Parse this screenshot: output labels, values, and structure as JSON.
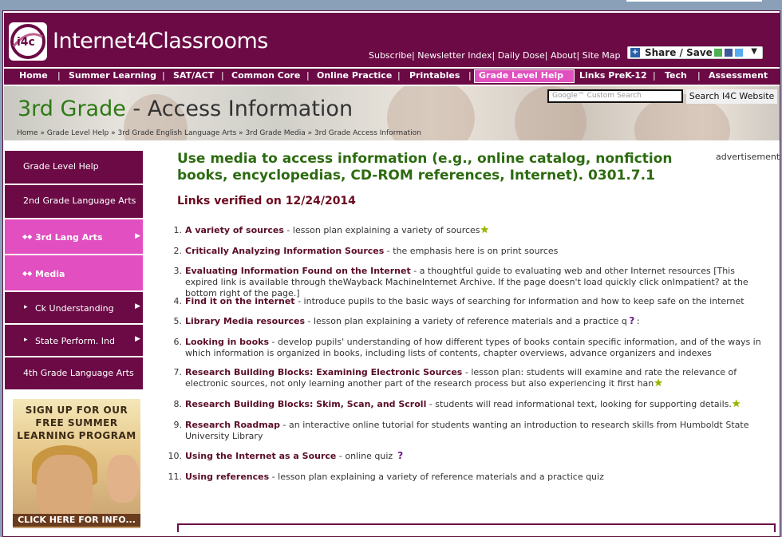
{
  "brand": "Internet4Classrooms",
  "logo_text": "i4c",
  "top_links": [
    "Subscribe",
    "Newsletter Index",
    "Daily Dose",
    "About",
    "Site Map"
  ],
  "share_label": "Share / Save",
  "nav": [
    "Home",
    "Summer Learning",
    "SAT/ACT",
    "Common Core",
    "Online Practice",
    "Printables",
    "Grade Level Help",
    "Links PreK-12",
    "Tech",
    "Assessment"
  ],
  "nav_active": "Grade Level Help",
  "page_title_part1": "3rd Grade",
  "page_title_part2": " - Access Information",
  "breadcrumbs": "Home » Grade Level Help » 3rd Grade English Language Arts » 3rd Grade Media » 3rd Grade Access Information",
  "search": {
    "placeholder": "Google™ Custom Search",
    "button": "Search I4C Website"
  },
  "sidebar": [
    {
      "label": "Grade Level Help"
    },
    {
      "label": "2nd Grade Language Arts"
    },
    {
      "label": "3rd Lang Arts"
    },
    {
      "label": "Media"
    },
    {
      "label": "Ck Understanding"
    },
    {
      "label": "State Perform. Ind"
    },
    {
      "label": "4th Grade Language Arts"
    }
  ],
  "promo": {
    "line1": "SIGN UP FOR OUR",
    "line2": "FREE SUMMER",
    "line3": "LEARNING PROGRAM",
    "cta": "CLICK HERE FOR INFO..."
  },
  "main_heading": "Use media to access information (e.g., online catalog, nonfiction books, encyclopedias, CD-ROM references, Internet). 0301.7.1",
  "verified": "Links verified on 12/24/2014",
  "advertisement": "advertisement",
  "links": [
    {
      "num": "1.",
      "title": "A variety of sources",
      "desc": " - lesson plan explaining a variety of sources"
    },
    {
      "num": "2.",
      "title": "Critically Analyzing Information Sources",
      "desc": " - the emphasis here is on print sources"
    },
    {
      "num": "3.",
      "title": "Evaluating Information Found on the Internet",
      "desc": "  - a thoughtful guide to evaluating web and other Internet resources [This expired link is available through theWayback MachineInternet Archive. If the page doesn't load quickly click onImpatient? at the bottom right of the page.]"
    },
    {
      "num": "4.",
      "title": "Find it on the internet",
      "desc": "  - introduce pupils to the basic ways of searching for information and how to keep safe on the internet"
    },
    {
      "num": "5.",
      "title": "Library Media resources",
      "desc": " - lesson plan explaining a variety of reference materials and a practice q"
    },
    {
      "num": "6.",
      "title": "Looking in books",
      "desc": "  - develop pupils' understanding of how different types of books contain specific information, and of the ways in which information is organized in books, including lists of contents, chapter overviews, advance organizers and indexes"
    },
    {
      "num": "7.",
      "title": "Research Building Blocks: Examining Electronic Sources",
      "desc": "  - lesson plan: students will examine and rate the relevance of electronic sources, not only learning another part of the research process but also experiencing it first han"
    },
    {
      "num": "8.",
      "title": "Research Building Blocks: Skim, Scan, and Scroll",
      "desc": "  - students will read informational text, looking for supporting details."
    },
    {
      "num": "9.",
      "title": "Research Roadmap",
      "desc": " - an interactive online tutorial for students wanting an introduction to research skills from Humboldt State University Library"
    },
    {
      "num": "10.",
      "title": "Using the Internet as a Source",
      "desc": "  - online quiz"
    },
    {
      "num": "11.",
      "title": "Using references",
      "desc": " - lesson plan explaining a variety of reference materials and a practice quiz"
    }
  ],
  "colors": {
    "brand": "#6b0a45",
    "nav_active": "#e24fc0",
    "heading": "#2c6b10",
    "verified": "#6b0a1f"
  }
}
